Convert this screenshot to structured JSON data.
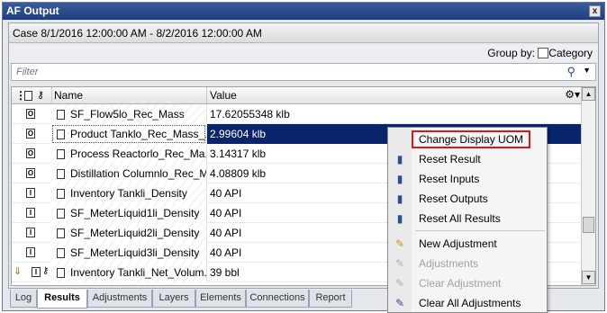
{
  "window": {
    "title": "AF Output",
    "close_glyph": "x"
  },
  "case": {
    "label": "Case 8/1/2016 12:00:00 AM  -  8/2/2016 12:00:00 AM"
  },
  "group_by": {
    "label": "Group by:",
    "option_label": "Category",
    "checked": false
  },
  "filter": {
    "placeholder": "Filter",
    "value": ""
  },
  "grid": {
    "columns": {
      "name": "Name",
      "value": "Value"
    },
    "header_icons": [
      "pin-icon",
      "doc-icon",
      "key-icon"
    ],
    "rows": [
      {
        "type": "O",
        "name": "SF_Flow5lo_Rec_Mass",
        "value": "17.62055348 klb",
        "selected": false
      },
      {
        "type": "O",
        "name": "Product Tanklo_Rec_Mass_...",
        "value": "2.99604 klb",
        "selected": true
      },
      {
        "type": "O",
        "name": "Process Reactorlo_Rec_Ma...",
        "value": "3.14317 klb",
        "selected": false
      },
      {
        "type": "O",
        "name": "Distillation Columnlo_Rec_M...",
        "value": "4.08809 klb",
        "selected": false
      },
      {
        "type": "I",
        "name": "Inventory Tankli_Density",
        "value": "40 API",
        "selected": false
      },
      {
        "type": "I",
        "name": "SF_MeterLiquid1li_Density",
        "value": "40 API",
        "selected": false
      },
      {
        "type": "I",
        "name": "SF_MeterLiquid2li_Density",
        "value": "40 API",
        "selected": false
      },
      {
        "type": "I",
        "name": "SF_MeterLiquid3li_Density",
        "value": "40 API",
        "selected": false
      },
      {
        "type": "I",
        "name": "Inventory Tankli_Net_Volum...",
        "value": "39 bbl",
        "selected": false
      }
    ]
  },
  "tabs": [
    {
      "label": "Log",
      "active": false
    },
    {
      "label": "Results",
      "active": true
    },
    {
      "label": "Adjustments",
      "active": false
    },
    {
      "label": "Layers",
      "active": false
    },
    {
      "label": "Elements",
      "active": false
    },
    {
      "label": "Connections",
      "active": false
    },
    {
      "label": "Report",
      "active": false
    }
  ],
  "context_menu": {
    "items": [
      {
        "label": "Change Display UOM",
        "icon": "none",
        "highlighted": true,
        "disabled": false
      },
      {
        "label": "Reset Result",
        "icon": "reset-result-icon",
        "disabled": false
      },
      {
        "label": "Reset Inputs",
        "icon": "reset-inputs-icon",
        "disabled": false
      },
      {
        "label": "Reset Outputs",
        "icon": "reset-outputs-icon",
        "disabled": false
      },
      {
        "label": "Reset All Results",
        "icon": "reset-all-icon",
        "disabled": false
      },
      {
        "label": "New Adjustment",
        "icon": "new-adjustment-icon",
        "disabled": false
      },
      {
        "label": "Adjustments",
        "icon": "adjustments-icon",
        "disabled": true
      },
      {
        "label": "Clear Adjustment",
        "icon": "clear-adjustment-icon",
        "disabled": true
      },
      {
        "label": "Clear All Adjustments",
        "icon": "clear-all-adjustments-icon",
        "disabled": false
      }
    ]
  },
  "colors": {
    "selection": "#0a246a",
    "highlight_border": "#e01515",
    "title_bar": "#2a4a8c"
  }
}
